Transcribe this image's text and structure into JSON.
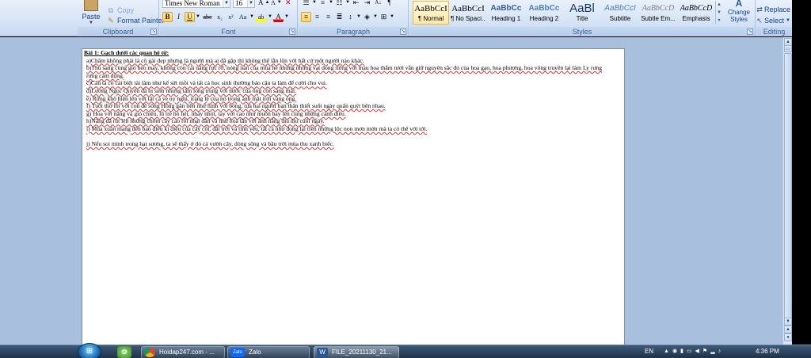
{
  "clipboard": {
    "paste_label": "Paste",
    "copy_label": "Copy",
    "format_painter_label": "Format Painter",
    "group_label": "Clipboard"
  },
  "font": {
    "family": "Times New Roman",
    "size": "16",
    "group_label": "Font",
    "bold": "B",
    "italic": "I",
    "underline": "U",
    "strikethrough": "abc",
    "subscript": "x₂",
    "superscript": "x²",
    "change_case": "Aa",
    "highlight": "ab",
    "font_color": "A"
  },
  "paragraph": {
    "group_label": "Paragraph"
  },
  "styles": {
    "group_label": "Styles",
    "items": [
      {
        "sample": "AaBbCcI",
        "name": "¶ Normal"
      },
      {
        "sample": "AaBbCcI",
        "name": "¶ No Spaci..."
      },
      {
        "sample": "AaBbCc",
        "name": "Heading 1"
      },
      {
        "sample": "AaBbCc",
        "name": "Heading 2"
      },
      {
        "sample": "AaBl",
        "name": "Title"
      },
      {
        "sample": "AaBbCcI",
        "name": "Subtitle"
      },
      {
        "sample": "AaBbCcD",
        "name": "Subtle Em..."
      },
      {
        "sample": "AaBbCcD",
        "name": "Emphasis"
      }
    ],
    "change_styles_label": "Change Styles"
  },
  "editing": {
    "group_label": "Editing",
    "replace_label": "Replace",
    "select_label": "Select"
  },
  "document": {
    "lines": [
      "Bài 1: Gạch dưới các quan hệ từ:",
      "a)Chăm không phải là cô gái đẹp nhưng là người mà ai đã gặp thì không thể lẫn lộn với bất cứ một người nào khác.",
      "b)Thu sang cùng gió heo may, không còn cái nắng rực rỡ, nóng nàn của mùa hè nhưng những vạt dong riềng với màu hoa thắm tươi vẫn giữ nguyên sắc đỏ của hoa gạo, hoa phượng, hoa vông truyền lại làm Ly rưng rưng cảm động.",
      "c)Câu ta có cái biệt tài làm như kể sứt mồi và tất cả học sinh thường bảo cậu ta làm để cười cho vui.",
      "d)Lương Ngọc Quyến đã hi sinh nhưng tấm lòng trung với nước của ông còn sáng mãi.",
      "e) Rừng khô hiện lên với tất cả vẻ uy nghi, tráng lệ của nó trong ánh mặt trời vàng óng.",
      "f) Tuổi thơ tôi với con đê sông Hồng gắn liền như hình với bóng, tựa hai người bạn thân thiết suốt ngày quấn quýt bên nhau.",
      "g) Hoa với nắng và gió chiều, lũ trẻ hò hét, nhảy nhót, tay với cao như muốn bay lên cùng những cánh diều.",
      "h)Nắng đã rút lên những chòm cây cao rồi nhạt dần và như hoà lẫn với ánh nắng dịu dịu cuối ngày.",
      "i) Mùa xuân mang đến bao điều kì diệu của cây cối, đất trời và tình yêu, tất cả như đọng lại trên những lộc non mơn mởn mà ta có thể với tới.",
      "",
      "j) Nếu soi mình trong hạt sương, ta sẽ thấy ở đó cả vườn cây, dòng sông và bầu trời mùa thu xanh biếc."
    ]
  },
  "taskbar": {
    "tasks": [
      {
        "label": "Hoidap247.com - ...",
        "icon": "chrome-icon"
      },
      {
        "label": "Zalo",
        "icon": "zalo-icon"
      },
      {
        "label": "FILE_20211130_21...",
        "icon": "word-icon"
      }
    ],
    "zalo_badge": "Zalo",
    "language": "EN",
    "time": "4:36 PM"
  },
  "colors": {
    "ribbon_bg": "#d6e4f5",
    "document_bg": "#a8bfdd",
    "selected_style": "#ffe9a8",
    "taskbar_bg": "#2b4360"
  }
}
